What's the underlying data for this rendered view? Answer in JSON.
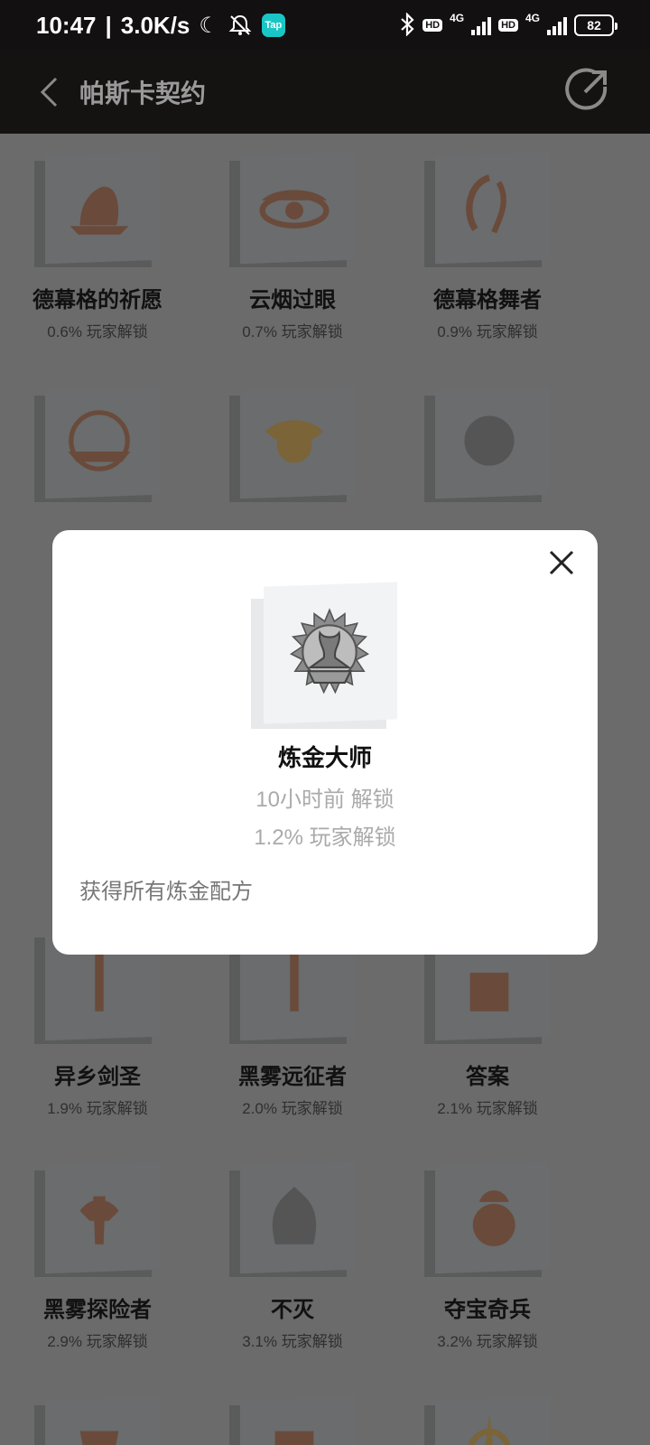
{
  "status": {
    "time": "10:47",
    "speed": "3.0K/s",
    "tap_badge": "Tap",
    "hd1": "HD",
    "net1": "4G",
    "hd2": "HD",
    "net2": "4G",
    "battery": "82"
  },
  "header": {
    "title": "帕斯卡契约"
  },
  "achievements": [
    {
      "name": "德幕格的祈愿",
      "pct": "0.6% 玩家解锁",
      "tone": "#6a4a3a"
    },
    {
      "name": "云烟过眼",
      "pct": "0.7% 玩家解锁",
      "tone": "#6a4a3a"
    },
    {
      "name": "德幕格舞者",
      "pct": "0.9% 玩家解锁",
      "tone": "#6a4a3a"
    },
    {
      "name": "",
      "pct": "",
      "tone": "#6a4a3a"
    },
    {
      "name": "",
      "pct": "",
      "tone": "#7a6438"
    },
    {
      "name": "",
      "pct": "",
      "tone": "#555"
    },
    {
      "name": "异乡剑圣",
      "pct": "1.9% 玩家解锁",
      "tone": "#6a4a3a"
    },
    {
      "name": "黑雾远征者",
      "pct": "2.0% 玩家解锁",
      "tone": "#6a4a3a"
    },
    {
      "name": "答案",
      "pct": "2.1% 玩家解锁",
      "tone": "#6a4a3a"
    },
    {
      "name": "黑雾探险者",
      "pct": "2.9% 玩家解锁",
      "tone": "#6a4a3a"
    },
    {
      "name": "不灭",
      "pct": "3.1% 玩家解锁",
      "tone": "#555"
    },
    {
      "name": "夺宝奇兵",
      "pct": "3.2% 玩家解锁",
      "tone": "#6a4a3a"
    },
    {
      "name": "",
      "pct": "",
      "tone": "#6a4a3a"
    },
    {
      "name": "",
      "pct": "",
      "tone": "#6a4a3a"
    },
    {
      "name": "",
      "pct": "",
      "tone": "#7a6438"
    }
  ],
  "modal": {
    "title": "炼金大师",
    "unlock_time": "10小时前 解锁",
    "pct": "1.2% 玩家解锁",
    "description": "获得所有炼金配方"
  }
}
